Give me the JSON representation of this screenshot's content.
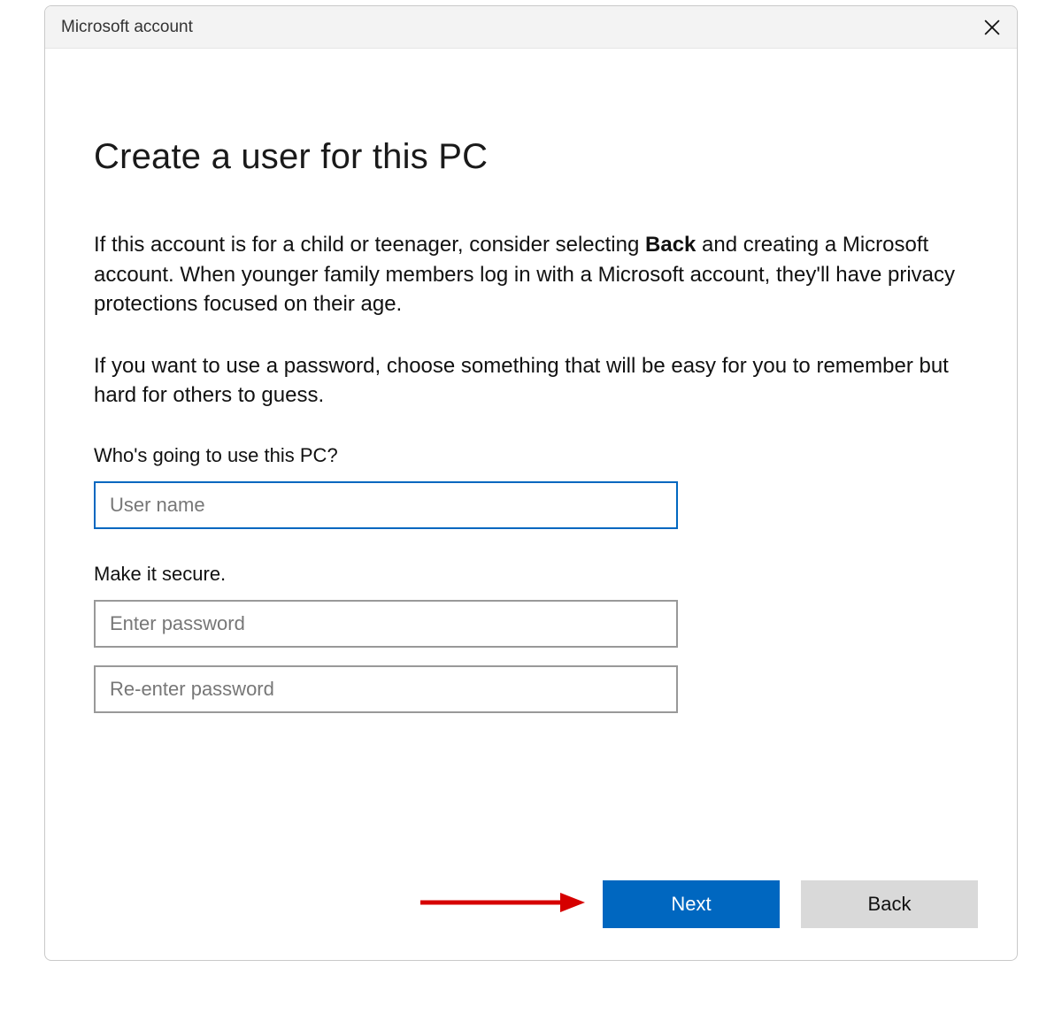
{
  "window": {
    "title": "Microsoft account"
  },
  "main": {
    "heading": "Create a user for this PC",
    "para1_a": "If this account is for a child or teenager, consider selecting ",
    "para1_bold": "Back",
    "para1_b": " and creating a Microsoft account. When younger family members log in with a Microsoft account, they'll have privacy protections focused on their age.",
    "para2": "If you want to use a password, choose something that will be easy for you to remember but hard for others to guess.",
    "username_label": "Who's going to use this PC?",
    "username_placeholder": "User name",
    "secure_label": "Make it secure.",
    "password_placeholder": "Enter password",
    "reenter_placeholder": "Re-enter password"
  },
  "footer": {
    "next_label": "Next",
    "back_label": "Back"
  },
  "colors": {
    "accent": "#0067c0",
    "annotation": "#d60000"
  }
}
